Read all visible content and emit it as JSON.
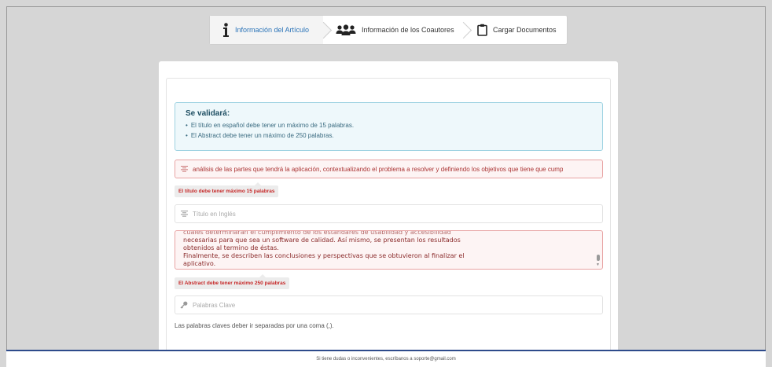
{
  "steps": [
    {
      "label": "Información del Artículo",
      "icon": "info-icon",
      "active": true
    },
    {
      "label": "Información de los Coautores",
      "icon": "users-icon",
      "active": false
    },
    {
      "label": "Cargar Documentos",
      "icon": "clipboard-icon",
      "active": false
    }
  ],
  "alert": {
    "title": "Se validará:",
    "items": [
      "El título en español debe tener un máximo de 15 palabras.",
      "El Abstract debe tener un máximo de 250 palabras."
    ]
  },
  "title_field": {
    "value": "análisis de las partes que tendrá la aplicación, contextualizando el problema a resolver y definiendo los objetivos que tiene que cump",
    "error": "El título debe tener máximo 15 palabras"
  },
  "english_title_field": {
    "placeholder": "Título en Inglés"
  },
  "abstract_field": {
    "lines": [
      "cuales determinaran el cumplimiento de los estándares de usabilidad y accesibilidad",
      "necesarias para que sea un software de calidad. Así mismo, se presentan los resultados",
      "obtenidos al termino de éstas.",
      "Finalmente, se describen las conclusiones y perspectivas que se obtuvieron al finalizar el",
      "aplicativo."
    ],
    "error": "El Abstract debe tener máximo 250 palabras"
  },
  "keywords_field": {
    "placeholder": "Palabras Clave",
    "hint": "Las palabras claves deber ir separadas por una coma (,)."
  },
  "footer": {
    "text": "Si tiene dudas o inconvenientes, escríbanos a soporte@gmail.com"
  },
  "colors": {
    "active_step": "#2b74b8",
    "error": "#c62828",
    "footer_border": "#2e4b8b"
  }
}
